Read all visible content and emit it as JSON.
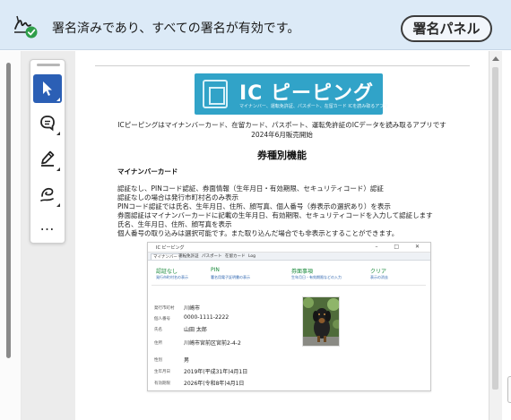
{
  "signature_bar": {
    "message": "署名済みであり、すべての署名が有効です。",
    "panel_button": "署名パネル",
    "icon": "signature-valid-icon"
  },
  "toolbar": {
    "tools": [
      {
        "name": "select-tool",
        "icon": "arrow-cursor-icon",
        "active": true
      },
      {
        "name": "comment-tool",
        "icon": "comment-bubble-icon",
        "active": false
      },
      {
        "name": "highlight-tool",
        "icon": "pen-highlight-icon",
        "active": false
      },
      {
        "name": "draw-tool",
        "icon": "freehand-draw-icon",
        "active": false
      }
    ],
    "more_label": "…"
  },
  "document": {
    "logo": {
      "title": "IC ピーピング",
      "subtitle": "マイナンバー、運転免許証、パスポート、在留カード ICを読み取るアプリ"
    },
    "intro_line1": "ICピーピングはマイナンバーカード、在留カード、パスポート、運転免許証のICデータを読み取るアプリです",
    "intro_line2": "2024年6月販売開始",
    "section_title": "券種別機能",
    "subsection": "マイナンバーカード",
    "lines": [
      "認証なし、PINコード認証、券面情報（生年月日・有効期限、セキュリティコード）認証",
      "認証なしの場合は発行市町村名のみ表示",
      "PINコード認証では氏名、生年月日、住所、顔写真、個人番号（券表示の選択あり）を表示",
      "券面認証はマイナンバーカードに記載の生年月日、有効期限、セキュリティコードを入力して認証します",
      "氏名、生年月日、住所、顔写真を表示",
      "個人番号の取り込みは選択可能です。また取り込んだ場合でも非表示とすることができます。"
    ],
    "embedded_app": {
      "window_title": "IC ピーピング",
      "window_controls": "–  □  ✕",
      "tabs": [
        "マイナンバー",
        "運転免許証",
        "パスポート",
        "在留カード",
        "Log"
      ],
      "selected_tab": 0,
      "heads": [
        {
          "title": "認証なし",
          "sub": "発行市町村名の表示"
        },
        {
          "title": "PIN",
          "sub": "署名用電子証明書の表示"
        },
        {
          "title": "券面事項",
          "sub": "生年月日・有効期限などの入力"
        },
        {
          "title": "クリア",
          "sub": "表示の消去"
        }
      ],
      "fields": [
        {
          "label": "発行市町村",
          "value": "川崎市"
        },
        {
          "label": "個人番号",
          "value": "0000-1111-2222"
        },
        {
          "label": "氏名",
          "value": "山田 太郎"
        },
        {
          "label": "住所",
          "value": "川崎市宮前区宮前2-4-2"
        },
        {
          "label": "性別",
          "value": "男"
        },
        {
          "label": "生年月日",
          "value": "2019年(平成31年)4月1日"
        },
        {
          "label": "有効期限",
          "value": "2026年(令和8年)4月1日"
        }
      ],
      "photo": "dog-photo"
    }
  },
  "colors": {
    "signature_bar": "#dceaf7",
    "accent": "#2b5fb5",
    "logo": "#31a3c8",
    "embedded_green": "#1a8a3c"
  }
}
